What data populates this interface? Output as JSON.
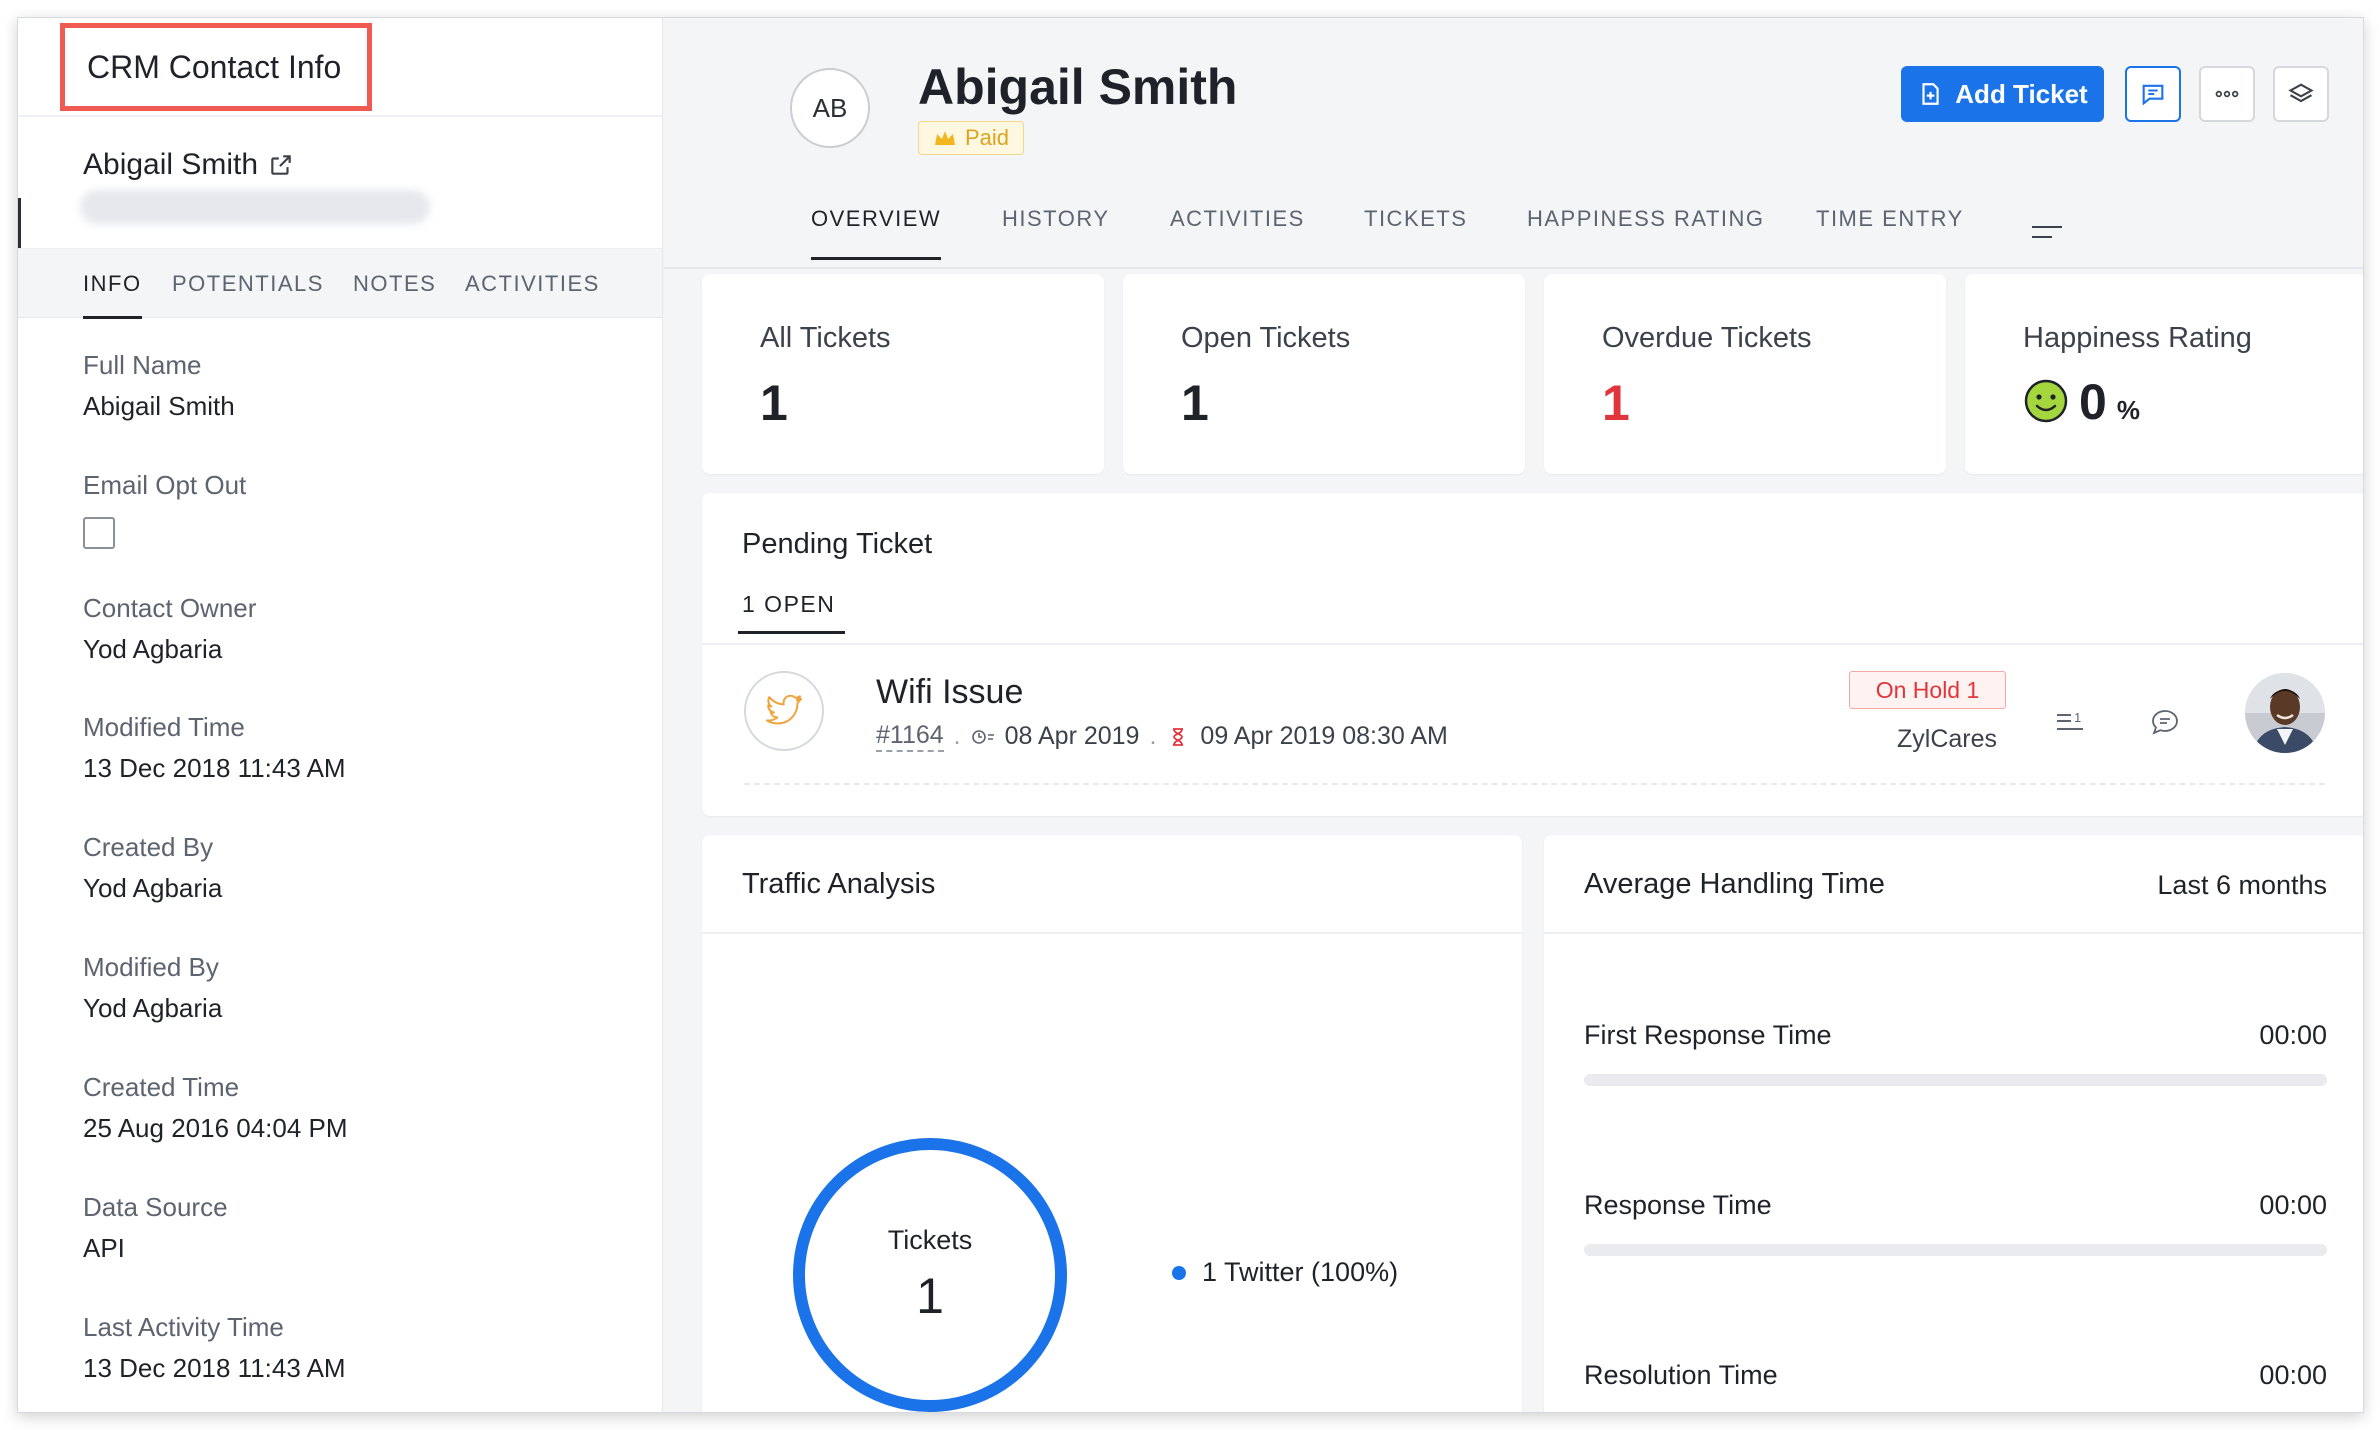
{
  "left_panel": {
    "title": "CRM Contact Info",
    "contact_name": "Abigail Smith",
    "tabs": [
      "INFO",
      "POTENTIALS",
      "NOTES",
      "ACTIVITIES"
    ],
    "active_tab": "INFO",
    "fields": [
      {
        "label": "Full Name",
        "value": "Abigail Smith"
      },
      {
        "label": "Email Opt Out",
        "type": "checkbox",
        "checked": false
      },
      {
        "label": "Contact Owner",
        "value": "Yod Agbaria"
      },
      {
        "label": "Modified Time",
        "value": "13 Dec 2018 11:43 AM"
      },
      {
        "label": "Created By",
        "value": "Yod Agbaria"
      },
      {
        "label": "Modified By",
        "value": "Yod Agbaria"
      },
      {
        "label": "Created Time",
        "value": "25 Aug 2016 04:04 PM"
      },
      {
        "label": "Data Source",
        "value": "API"
      },
      {
        "label": "Last Activity Time",
        "value": "13 Dec 2018 11:43 AM"
      }
    ]
  },
  "header": {
    "initials": "AB",
    "name": "Abigail Smith",
    "badge": "Paid",
    "add_ticket_label": "Add Ticket",
    "tabs": [
      "OVERVIEW",
      "HISTORY",
      "ACTIVITIES",
      "TICKETS",
      "HAPPINESS RATING",
      "TIME ENTRY"
    ],
    "active_tab": "OVERVIEW"
  },
  "stats": {
    "all_tickets": {
      "label": "All Tickets",
      "value": "1"
    },
    "open_tickets": {
      "label": "Open Tickets",
      "value": "1"
    },
    "overdue_tickets": {
      "label": "Overdue Tickets",
      "value": "1"
    },
    "happiness_rating": {
      "label": "Happiness Rating",
      "value": "0",
      "unit": "%"
    }
  },
  "pending": {
    "title": "Pending Ticket",
    "tab": "1 OPEN",
    "ticket": {
      "subject": "Wifi Issue",
      "id": "#1164",
      "created": "08 Apr 2019",
      "due": "09 Apr 2019 08:30 AM",
      "status": "On Hold 1",
      "department": "ZylCares",
      "thread_count": "1"
    }
  },
  "traffic": {
    "title": "Traffic Analysis",
    "center_label": "Tickets",
    "center_value": "1",
    "legend": "1 Twitter (100%)"
  },
  "aht": {
    "title": "Average Handling Time",
    "period": "Last 6 months",
    "rows": [
      {
        "label": "First Response Time",
        "value": "00:00",
        "progress": 0
      },
      {
        "label": "Response Time",
        "value": "00:00",
        "progress": 0
      },
      {
        "label": "Resolution Time",
        "value": "00:00",
        "progress": 0
      }
    ]
  },
  "colors": {
    "accent": "#1a73e8",
    "danger": "#e0353d",
    "highlight_box": "#ef5b52",
    "paid": "#d9a520"
  }
}
